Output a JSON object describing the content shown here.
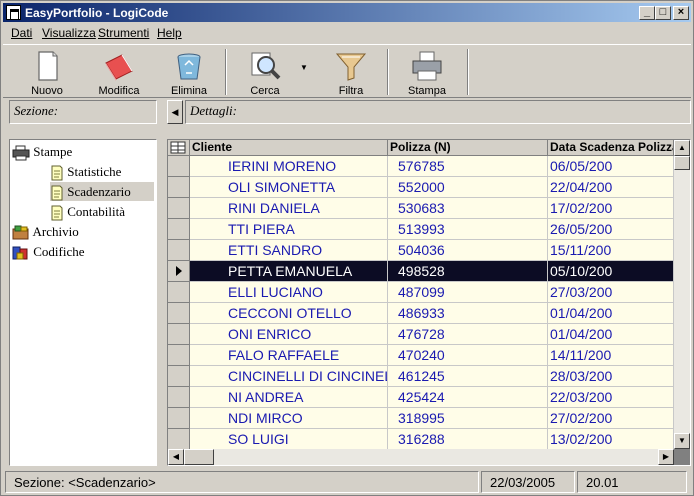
{
  "window": {
    "title": "EasyPortfolio - LogiCode"
  },
  "menu": [
    {
      "label": "Dati"
    },
    {
      "label": "Visualizza"
    },
    {
      "label": "Strumenti"
    },
    {
      "label": "Help"
    }
  ],
  "toolbar": {
    "nuovo": "Nuovo",
    "modifica": "Modifica",
    "elimina": "Elimina",
    "cerca": "Cerca",
    "filtra": "Filtra",
    "stampa": "Stampa"
  },
  "panels": {
    "sezione": "Sezione:",
    "dettagli": "Dettagli:"
  },
  "tree": [
    {
      "label": "Stampe",
      "icon": "printer-icon"
    },
    {
      "label": "Statistiche",
      "icon": "document-icon"
    },
    {
      "label": "Scadenzario",
      "icon": "document-icon",
      "selected": true
    },
    {
      "label": "Contabilità",
      "icon": "document-icon"
    },
    {
      "label": "Archivio",
      "icon": "archive-icon"
    },
    {
      "label": "Codifiche",
      "icon": "codes-icon"
    }
  ],
  "grid": {
    "columns": [
      "Cliente",
      "Polizza (N)",
      "Data Scadenza Polizza"
    ],
    "rows": [
      [
        "IERINI MORENO",
        "576785",
        "06/05/200"
      ],
      [
        "OLI SIMONETTA",
        "552000",
        "22/04/200"
      ],
      [
        "RINI DANIELA",
        "530683",
        "17/02/200"
      ],
      [
        "TTI PIERA",
        "513993",
        "26/05/200"
      ],
      [
        "ETTI SANDRO",
        "504036",
        "15/11/200"
      ],
      [
        "PETTA EMANUELA",
        "498528",
        "05/10/200"
      ],
      [
        "ELLI LUCIANO",
        "487099",
        "27/03/200"
      ],
      [
        "CECCONI OTELLO",
        "486933",
        "01/04/200"
      ],
      [
        "ONI ENRICO",
        "476728",
        "01/04/200"
      ],
      [
        "FALO RAFFAELE",
        "470240",
        "14/11/200"
      ],
      [
        "CINCINELLI DI CINCINEL",
        "461245",
        "28/03/200"
      ],
      [
        "NI ANDREA",
        "425424",
        "22/03/200"
      ],
      [
        "NDI MIRCO",
        "318995",
        "27/02/200"
      ],
      [
        "SO LUIGI",
        "316288",
        "13/02/200"
      ]
    ],
    "active_row": 5
  },
  "status": {
    "sezione": "Sezione: <Scadenzario>",
    "date": "22/03/2005",
    "time": "20.01"
  }
}
